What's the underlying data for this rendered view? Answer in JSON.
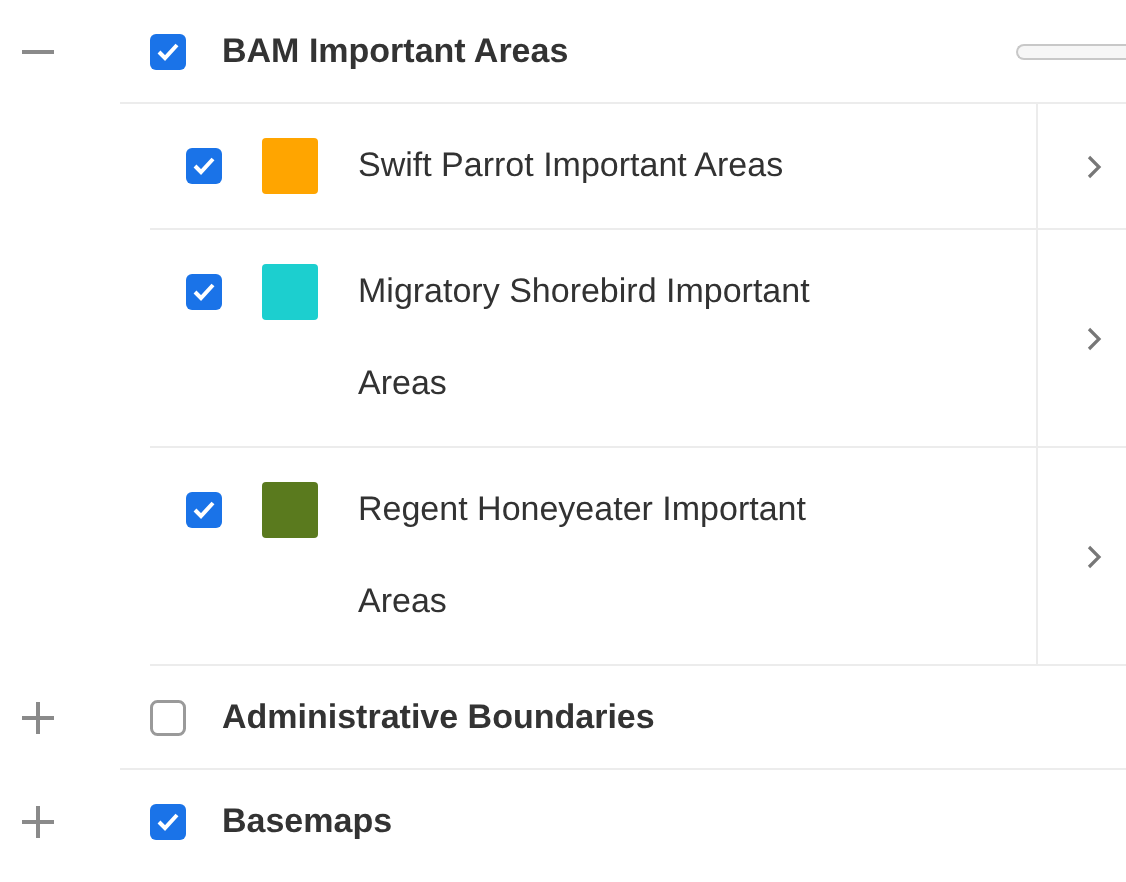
{
  "groups": [
    {
      "label": "BAM Important Areas",
      "expanded": true,
      "checked": true,
      "children": [
        {
          "label": "Swift Parrot Important Areas",
          "checked": true,
          "color": "#ffa500"
        },
        {
          "label": "Migratory Shorebird Important Areas",
          "checked": true,
          "color": "#1ccfcf"
        },
        {
          "label": "Regent Honeyeater Important Areas",
          "checked": true,
          "color": "#5a7a1e"
        }
      ]
    },
    {
      "label": "Administrative Boundaries",
      "expanded": false,
      "checked": false
    },
    {
      "label": "Basemaps",
      "expanded": false,
      "checked": true
    }
  ]
}
